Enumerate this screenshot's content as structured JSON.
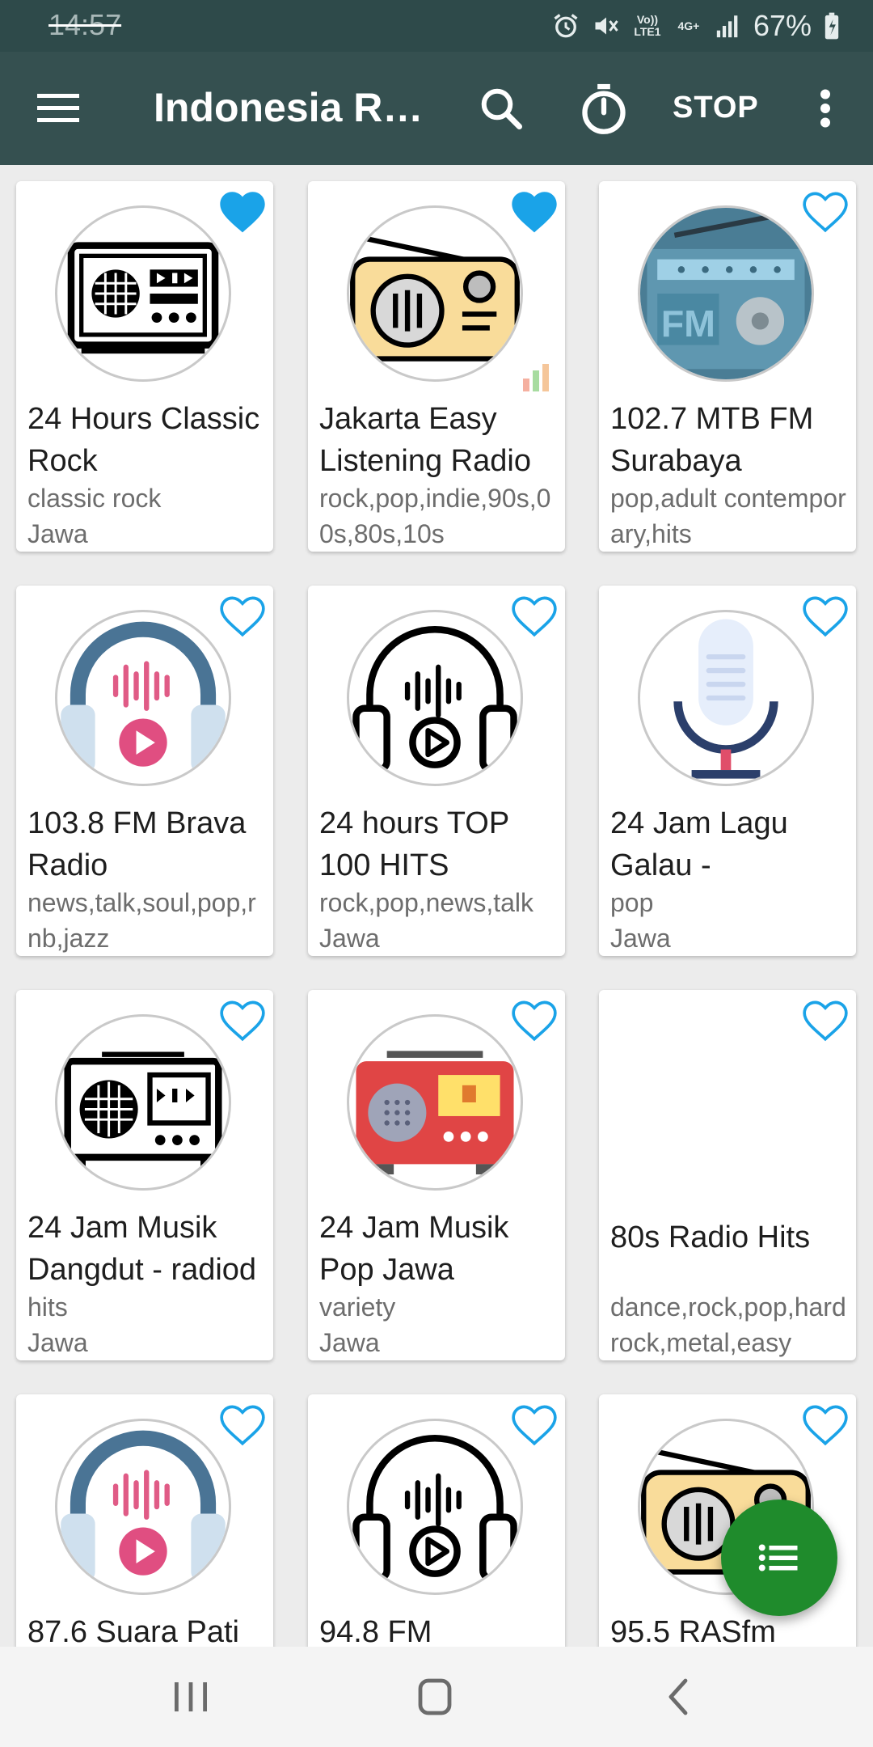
{
  "status": {
    "time": "14:57",
    "volte": "Vo)) LTE1",
    "net": "4G+",
    "battery": "67%"
  },
  "app": {
    "title": "Indonesia Radio",
    "stop_label": "STOP"
  },
  "stations": [
    {
      "name": "24 Hours Classic Rock",
      "genre": "classic rock",
      "location": "Jawa",
      "favorite": true,
      "icon": "radio-cassette-black-icon"
    },
    {
      "name": "Jakarta Easy Listening Radio",
      "genre": "rock,pop,indie,90s,00s,80s,10s",
      "location": "",
      "favorite": true,
      "icon": "radio-yellow-icon",
      "playing": true
    },
    {
      "name": "102.7 MTB FM Surabaya",
      "genre": "pop,adult contemporary,hits",
      "location": "",
      "favorite": false,
      "icon": "radio-fm-blue-icon"
    },
    {
      "name": "103.8 FM Brava Radio",
      "genre": "news,talk,soul,pop,rnb,jazz",
      "location": "",
      "favorite": false,
      "icon": "headphones-color-icon"
    },
    {
      "name": "24 hours TOP 100 HITS",
      "genre": "rock,pop,news,talk",
      "location": "Jawa",
      "favorite": false,
      "icon": "headphones-black-icon"
    },
    {
      "name": "24 Jam Lagu Galau -",
      "genre": "pop",
      "location": "Jawa",
      "favorite": false,
      "icon": "microphone-icon"
    },
    {
      "name": "24 Jam Musik Dangdut - radiod",
      "genre": "hits",
      "location": "Jawa",
      "favorite": false,
      "icon": "radio-boombox-black-icon"
    },
    {
      "name": "24 Jam Musik Pop Jawa",
      "genre": "variety",
      "location": "Jawa",
      "favorite": false,
      "icon": "radio-red-icon"
    },
    {
      "name": "80s Radio Hits",
      "genre": "dance,rock,pop,hard rock,metal,easy",
      "location": "",
      "favorite": false,
      "icon": ""
    },
    {
      "name": "87.6 Suara Pati",
      "genre": "",
      "location": "",
      "favorite": false,
      "icon": "headphones-color-icon"
    },
    {
      "name": "94.8 FM",
      "genre": "",
      "location": "",
      "favorite": false,
      "icon": "headphones-black-icon"
    },
    {
      "name": "95.5 RASfm",
      "genre": "",
      "location": "",
      "favorite": false,
      "icon": "radio-yellow-icon"
    }
  ],
  "colors": {
    "status_bar": "#2e4a4a",
    "app_bar": "#355050",
    "heart": "#1aa3e8",
    "fab": "#1f8b2c"
  }
}
